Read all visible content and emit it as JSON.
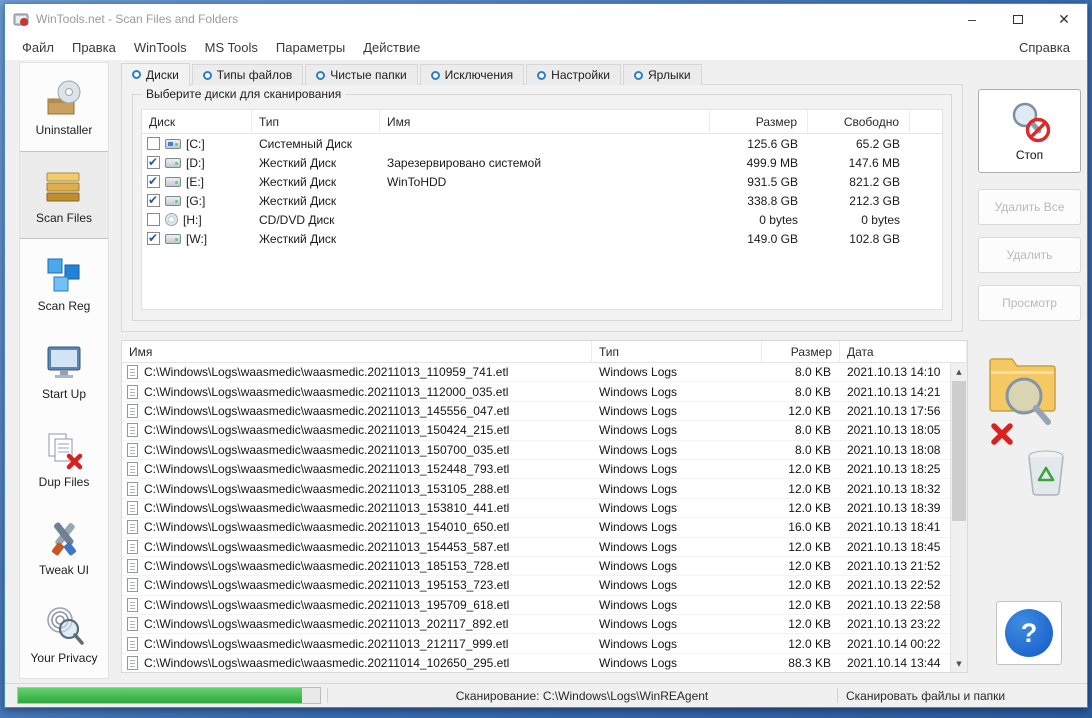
{
  "colors": {
    "accent": "#2a7fc9",
    "progress-green": "#2fa83f",
    "danger": "#e02020",
    "help-blue": "#1458c8"
  },
  "window": {
    "title": "WinTools.net - Scan Files and Folders"
  },
  "window_controls": {
    "minimize": "–",
    "close": "✕"
  },
  "menu": {
    "items": [
      "Файл",
      "Правка",
      "WinTools",
      "MS Tools",
      "Параметры",
      "Действие"
    ],
    "help": "Справка"
  },
  "sidebar": {
    "items": [
      {
        "label": "Uninstaller",
        "icon": "uninstaller-icon",
        "selected": false
      },
      {
        "label": "Scan Files",
        "icon": "scan-files-icon",
        "selected": true
      },
      {
        "label": "Scan Reg",
        "icon": "scan-reg-icon",
        "selected": false
      },
      {
        "label": "Start Up",
        "icon": "startup-icon",
        "selected": false
      },
      {
        "label": "Dup Files",
        "icon": "dup-files-icon",
        "selected": false
      },
      {
        "label": "Tweak UI",
        "icon": "tweak-ui-icon",
        "selected": false
      },
      {
        "label": "Your Privacy",
        "icon": "privacy-icon",
        "selected": false
      }
    ]
  },
  "tabs": [
    {
      "label": "Диски",
      "selected": true
    },
    {
      "label": "Типы файлов",
      "selected": false
    },
    {
      "label": "Чистые папки",
      "selected": false
    },
    {
      "label": "Исключения",
      "selected": false
    },
    {
      "label": "Настройки",
      "selected": false
    },
    {
      "label": "Ярлыки",
      "selected": false
    }
  ],
  "disk_panel": {
    "group_title": "Выберите диски для сканирования",
    "columns": [
      "Диск",
      "Тип",
      "Имя",
      "Размер",
      "Свободно"
    ],
    "rows": [
      {
        "checked": false,
        "icon": "system",
        "drive": "[C:]",
        "type": "Системный Диск",
        "name": "",
        "size": "125.6 GB",
        "free": "65.2 GB"
      },
      {
        "checked": true,
        "icon": "hdd",
        "drive": "[D:]",
        "type": "Жесткий Диск",
        "name": "Зарезервировано системой",
        "size": "499.9 MB",
        "free": "147.6 MB"
      },
      {
        "checked": true,
        "icon": "hdd",
        "drive": "[E:]",
        "type": "Жесткий Диск",
        "name": "WinToHDD",
        "size": "931.5 GB",
        "free": "821.2 GB"
      },
      {
        "checked": true,
        "icon": "hdd",
        "drive": "[G:]",
        "type": "Жесткий Диск",
        "name": "",
        "size": "338.8 GB",
        "free": "212.3 GB"
      },
      {
        "checked": false,
        "icon": "cd",
        "drive": "[H:]",
        "type": "CD/DVD Диск",
        "name": "",
        "size": "0 bytes",
        "free": "0 bytes"
      },
      {
        "checked": true,
        "icon": "hdd",
        "drive": "[W:]",
        "type": "Жесткий Диск",
        "name": "",
        "size": "149.0 GB",
        "free": "102.8 GB"
      }
    ]
  },
  "file_list": {
    "columns": [
      "Имя",
      "Тип",
      "Размер",
      "Дата"
    ],
    "rows": [
      {
        "name": "C:\\Windows\\Logs\\waasmedic\\waasmedic.20211013_110959_741.etl",
        "type": "Windows Logs",
        "size": "8.0 KB",
        "date": "2021.10.13 14:10"
      },
      {
        "name": "C:\\Windows\\Logs\\waasmedic\\waasmedic.20211013_112000_035.etl",
        "type": "Windows Logs",
        "size": "8.0 KB",
        "date": "2021.10.13 14:21"
      },
      {
        "name": "C:\\Windows\\Logs\\waasmedic\\waasmedic.20211013_145556_047.etl",
        "type": "Windows Logs",
        "size": "12.0 KB",
        "date": "2021.10.13 17:56"
      },
      {
        "name": "C:\\Windows\\Logs\\waasmedic\\waasmedic.20211013_150424_215.etl",
        "type": "Windows Logs",
        "size": "8.0 KB",
        "date": "2021.10.13 18:05"
      },
      {
        "name": "C:\\Windows\\Logs\\waasmedic\\waasmedic.20211013_150700_035.etl",
        "type": "Windows Logs",
        "size": "8.0 KB",
        "date": "2021.10.13 18:08"
      },
      {
        "name": "C:\\Windows\\Logs\\waasmedic\\waasmedic.20211013_152448_793.etl",
        "type": "Windows Logs",
        "size": "12.0 KB",
        "date": "2021.10.13 18:25"
      },
      {
        "name": "C:\\Windows\\Logs\\waasmedic\\waasmedic.20211013_153105_288.etl",
        "type": "Windows Logs",
        "size": "12.0 KB",
        "date": "2021.10.13 18:32"
      },
      {
        "name": "C:\\Windows\\Logs\\waasmedic\\waasmedic.20211013_153810_441.etl",
        "type": "Windows Logs",
        "size": "12.0 KB",
        "date": "2021.10.13 18:39"
      },
      {
        "name": "C:\\Windows\\Logs\\waasmedic\\waasmedic.20211013_154010_650.etl",
        "type": "Windows Logs",
        "size": "16.0 KB",
        "date": "2021.10.13 18:41"
      },
      {
        "name": "C:\\Windows\\Logs\\waasmedic\\waasmedic.20211013_154453_587.etl",
        "type": "Windows Logs",
        "size": "12.0 KB",
        "date": "2021.10.13 18:45"
      },
      {
        "name": "C:\\Windows\\Logs\\waasmedic\\waasmedic.20211013_185153_728.etl",
        "type": "Windows Logs",
        "size": "12.0 KB",
        "date": "2021.10.13 21:52"
      },
      {
        "name": "C:\\Windows\\Logs\\waasmedic\\waasmedic.20211013_195153_723.etl",
        "type": "Windows Logs",
        "size": "12.0 KB",
        "date": "2021.10.13 22:52"
      },
      {
        "name": "C:\\Windows\\Logs\\waasmedic\\waasmedic.20211013_195709_618.etl",
        "type": "Windows Logs",
        "size": "12.0 KB",
        "date": "2021.10.13 22:58"
      },
      {
        "name": "C:\\Windows\\Logs\\waasmedic\\waasmedic.20211013_202117_892.etl",
        "type": "Windows Logs",
        "size": "12.0 KB",
        "date": "2021.10.13 23:22"
      },
      {
        "name": "C:\\Windows\\Logs\\waasmedic\\waasmedic.20211013_212117_999.etl",
        "type": "Windows Logs",
        "size": "12.0 KB",
        "date": "2021.10.14 00:22"
      },
      {
        "name": "C:\\Windows\\Logs\\waasmedic\\waasmedic.20211014_102650_295.etl",
        "type": "Windows Logs",
        "size": "88.3 KB",
        "date": "2021.10.14 13:44"
      }
    ]
  },
  "actions": {
    "stop": "Стоп",
    "delete_all": "Удалить Все",
    "delete": "Удалить",
    "preview": "Просмотр"
  },
  "statusbar": {
    "progress_percent": 94,
    "scanning": "Сканирование: C:\\Windows\\Logs\\WinREAgent",
    "mode": "Сканировать файлы и папки"
  }
}
